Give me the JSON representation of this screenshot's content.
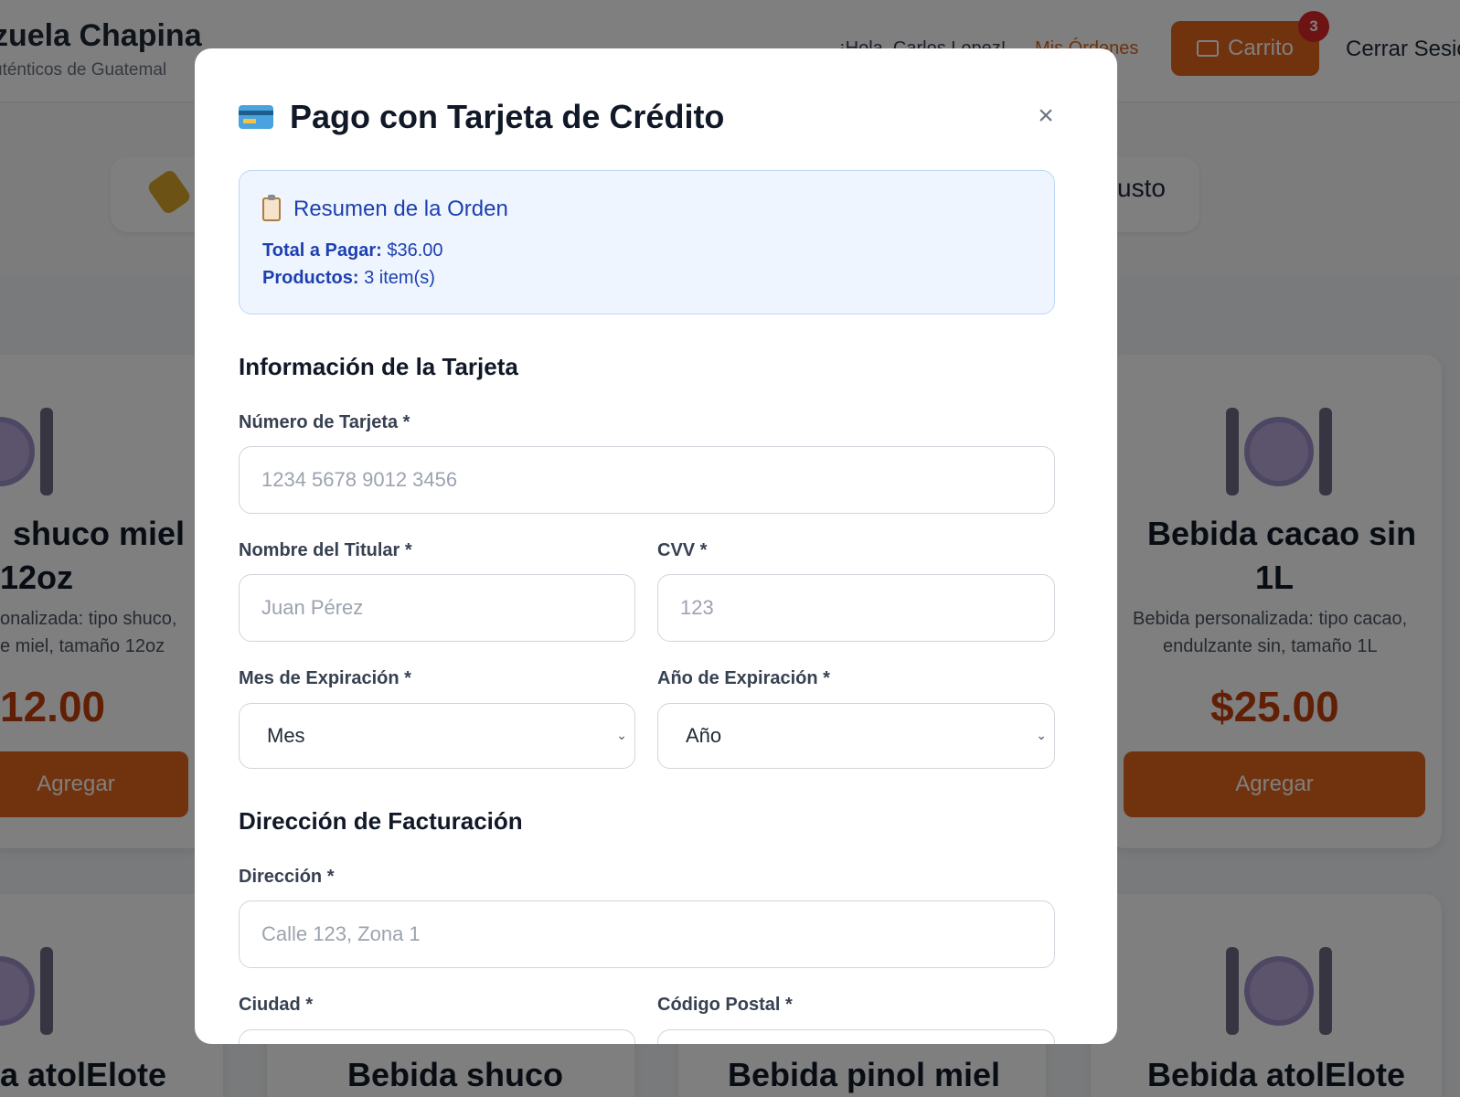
{
  "background": {
    "brand_title": "zuela Chapina",
    "brand_subtitle": "uténticos de Guatemal",
    "greeting": "¡Hola, Carlos Lopez!",
    "orders_link": "Mis Órdenes",
    "cart_label": "Carrito",
    "cart_count": "3",
    "logout_label": "Cerrar Sesió",
    "filter_partial_text": "usto",
    "cards_row1": [
      {
        "title_line1": "shuco miel",
        "title_line2": "12oz",
        "desc_line1": "onalizada: tipo shuco,",
        "desc_line2": "e miel, tamaño 12oz",
        "price": "12.00",
        "button": "Agregar"
      },
      {
        "title_line1": "Bebida cacao sin",
        "title_line2": "1L",
        "desc_line1": "Bebida personalizada: tipo cacao,",
        "desc_line2": "endulzante sin, tamaño 1L",
        "price": "$25.00",
        "button": "Agregar"
      }
    ],
    "cards_row2_titles": [
      "a atolElote",
      "Bebida shuco",
      "Bebida pinol miel",
      "Bebida atolElote"
    ]
  },
  "modal": {
    "title": "Pago con Tarjeta de Crédito",
    "close_symbol": "×",
    "summary": {
      "title": "Resumen de la Orden",
      "total_label": "Total a Pagar:",
      "total_value": "$36.00",
      "products_label": "Productos:",
      "products_value": "3 item(s)"
    },
    "card_section_title": "Información de la Tarjeta",
    "card_number_label": "Número de Tarjeta *",
    "card_number_placeholder": "1234 5678 9012 3456",
    "holder_label": "Nombre del Titular *",
    "holder_placeholder": "Juan Pérez",
    "cvv_label": "CVV *",
    "cvv_placeholder": "123",
    "exp_month_label": "Mes de Expiración *",
    "exp_month_value": "Mes",
    "exp_year_label": "Año de Expiración *",
    "exp_year_value": "Año",
    "billing_section_title": "Dirección de Facturación",
    "address_label": "Dirección *",
    "address_placeholder": "Calle 123, Zona 1",
    "city_label": "Ciudad *",
    "postal_label": "Código Postal *"
  },
  "colors": {
    "accent_orange": "#e2651c",
    "price_orange": "#c2410c",
    "summary_blue": "#1e40af",
    "summary_bg": "#eef5ff",
    "badge_red": "#dc2626"
  },
  "icons": [
    "credit-card-icon",
    "clipboard-icon",
    "close-icon",
    "cart-icon",
    "plate-icon",
    "chevron-down-icon"
  ]
}
